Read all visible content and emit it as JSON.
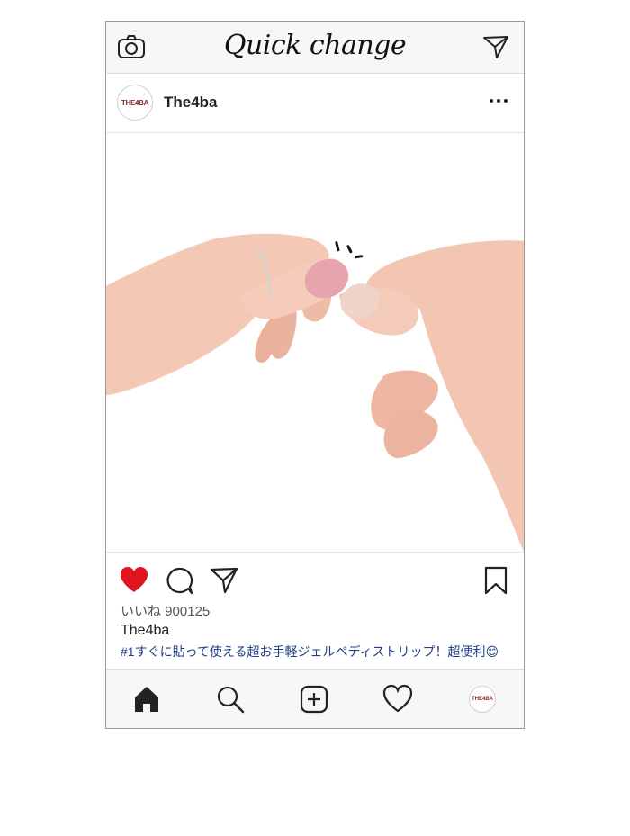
{
  "header": {
    "title": "Quick change",
    "left_icon": "camera-icon",
    "right_icon": "send-icon"
  },
  "post": {
    "username": "The4ba",
    "avatar_text": "THE4BA",
    "more_icon": "more-icon",
    "image_subject": "hands-applying-gel-nail-strip",
    "liked": true,
    "likes_text": "いいね 900125",
    "caption_user": "The4ba",
    "caption_text": "#1すぐに貼って使える超お手軽ジェルペディストリップ！超便利😊"
  },
  "bottom_nav": {
    "items": [
      "home-icon",
      "search-icon",
      "add-icon",
      "heart-icon",
      "profile-avatar"
    ],
    "avatar_text": "THE4BA"
  },
  "colors": {
    "like_red": "#e0141e",
    "caption_blue": "#1f3f85",
    "bar_bg": "#f7f7f7"
  }
}
